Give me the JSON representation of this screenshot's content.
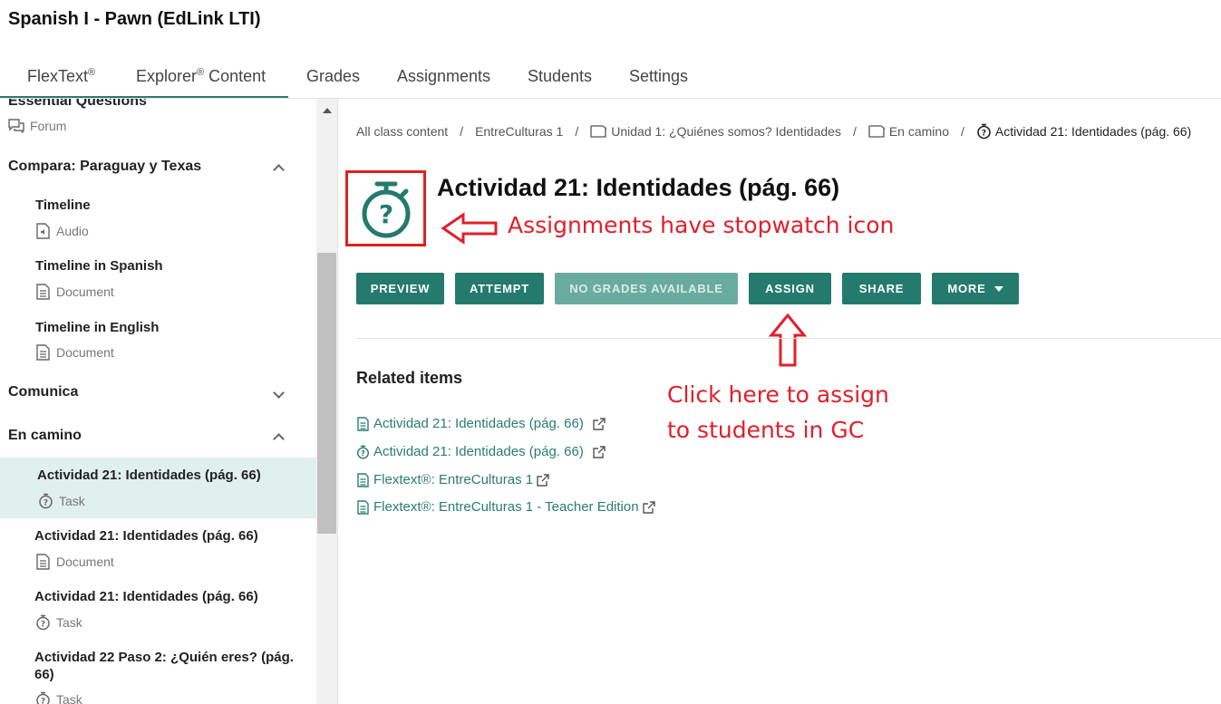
{
  "app": {
    "title": "Spanish I - Pawn (EdLink LTI)"
  },
  "tabs": [
    {
      "label": "FlexText",
      "sup": "®"
    },
    {
      "label": "Explorer",
      "sup": "®",
      "suffix": " Content"
    },
    {
      "label": "Grades"
    },
    {
      "label": "Assignments"
    },
    {
      "label": "Students"
    },
    {
      "label": "Settings"
    }
  ],
  "sidebar": {
    "partial_section": {
      "title": "Essential Questions",
      "sub": "Forum"
    },
    "sections": [
      {
        "title": "Compara: Paraguay y Texas",
        "expanded": true,
        "items": [
          {
            "title": "Timeline",
            "type": "Audio"
          },
          {
            "title": "Timeline in Spanish",
            "type": "Document"
          },
          {
            "title": "Timeline in English",
            "type": "Document"
          }
        ]
      },
      {
        "title": "Comunica",
        "expanded": false,
        "items": []
      },
      {
        "title": "En camino",
        "expanded": true,
        "items": [
          {
            "title": "Actividad 21: Identidades (pág. 66)",
            "type": "Task",
            "selected": true
          },
          {
            "title": "Actividad 21: Identidades (pág. 66)",
            "type": "Document"
          },
          {
            "title": "Actividad 21: Identidades (pág. 66)",
            "type": "Task"
          },
          {
            "title": "Actividad 22 Paso 2: ¿Quién eres? (pág. 66)",
            "type": "Task"
          }
        ]
      }
    ]
  },
  "breadcrumb": [
    {
      "label": "All class content"
    },
    {
      "label": "EntreCulturas 1"
    },
    {
      "label": "Unidad 1: ¿Quiénes somos? Identidades",
      "icon": "folder-icon"
    },
    {
      "label": "En camino",
      "icon": "folder-icon"
    },
    {
      "label": "Actividad 21: Identidades (pág. 66)",
      "icon": "stopwatch-icon"
    }
  ],
  "content": {
    "title": "Actividad 21: Identidades (pág. 66)",
    "icon": "stopwatch-icon",
    "buttons": {
      "preview": "PREVIEW",
      "attempt": "ATTEMPT",
      "no_grades": "NO GRADES AVAILABLE",
      "assign": "ASSIGN",
      "share": "SHARE",
      "more": "MORE"
    },
    "related_title": "Related items",
    "related": [
      {
        "label": "Actividad 21: Identidades (pág. 66)",
        "icon": "document-icon"
      },
      {
        "label": "Actividad 21: Identidades (pág. 66)",
        "icon": "stopwatch-icon"
      },
      {
        "label": "Flextext®: EntreCulturas 1",
        "icon": "document-icon"
      },
      {
        "label": "Flextext®: EntreCulturas 1 - Teacher Edition",
        "icon": "document-icon"
      }
    ]
  },
  "annotations": {
    "stopwatch_note": "Assignments have stopwatch icon",
    "assign_note_line1": "Click here to assign",
    "assign_note_line2": "to students in GC"
  },
  "colors": {
    "accent": "#247a6d",
    "annotation": "#e0202a",
    "selected_bg": "#e0f0ec"
  }
}
